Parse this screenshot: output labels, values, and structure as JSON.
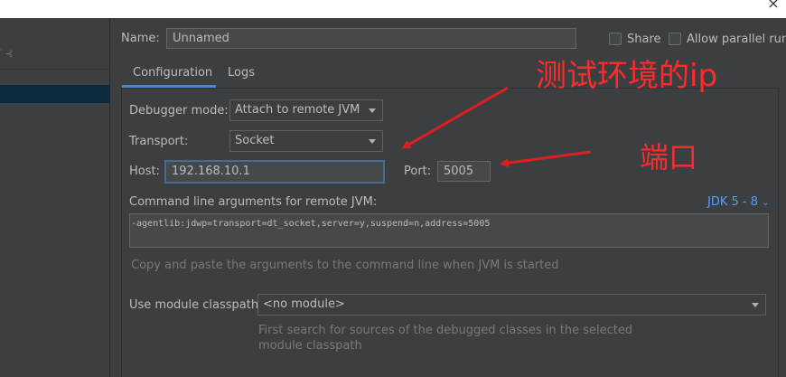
{
  "window": {
    "close_glyph": "×"
  },
  "left_panel": {
    "cut_text": "ﾞ⊰"
  },
  "name": {
    "label": "Name:",
    "value": "Unnamed"
  },
  "options": {
    "share": "Share",
    "parallel": "Allow parallel run"
  },
  "tabs": [
    {
      "label": "Configuration",
      "active": true
    },
    {
      "label": "Logs",
      "active": false
    }
  ],
  "debugger_mode": {
    "label": "Debugger mode:",
    "value": "Attach to remote JVM"
  },
  "transport": {
    "label": "Transport:",
    "value": "Socket"
  },
  "host": {
    "label": "Host:",
    "value": "192.168.10.1"
  },
  "port": {
    "label": "Port:",
    "value": "5005"
  },
  "cmd": {
    "label": "Command line arguments for remote JVM:",
    "jdk_link": "JDK 5 - 8",
    "value": "-agentlib:jdwp=transport=dt_socket,server=y,suspend=n,address=5005",
    "hint": "Copy and paste the arguments to the command line when JVM is started"
  },
  "module": {
    "label": "Use module classpath:",
    "value": "<no module>",
    "hint_line1": "First search for sources of the debugged classes in the selected",
    "hint_line2": "module classpath"
  },
  "annotations": {
    "ip": "测试环境的ip",
    "port": "端口"
  },
  "colors": {
    "background": "#3c3f41",
    "field": "#45494a",
    "accent": "#4a88c7",
    "link": "#589df6",
    "annotation": "#ff2a2a"
  }
}
